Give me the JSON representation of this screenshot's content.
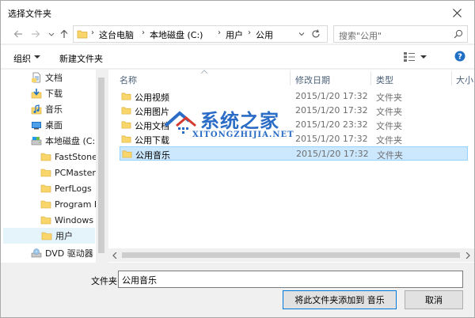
{
  "window": {
    "title": "选择文件夹"
  },
  "address": {
    "crumbs": [
      "这台电脑",
      "本地磁盘 (C:)",
      "用户",
      "公用"
    ]
  },
  "search": {
    "placeholder": "搜索\"公用\""
  },
  "toolbar": {
    "organize": "组织",
    "new_folder": "新建文件夹"
  },
  "sidebar": {
    "items": [
      {
        "label": "文档",
        "icon": "documents-icon"
      },
      {
        "label": "下载",
        "icon": "downloads-icon"
      },
      {
        "label": "音乐",
        "icon": "music-icon"
      },
      {
        "label": "桌面",
        "icon": "desktop-icon"
      },
      {
        "label": "本地磁盘 (C:)",
        "icon": "drive-icon"
      },
      {
        "label": "FastStone",
        "icon": "folder-icon"
      },
      {
        "label": "PCMaster",
        "icon": "folder-icon"
      },
      {
        "label": "PerfLogs",
        "icon": "folder-icon"
      },
      {
        "label": "Program F",
        "icon": "folder-icon"
      },
      {
        "label": "Windows",
        "icon": "folder-icon"
      },
      {
        "label": "用户",
        "icon": "folder-icon",
        "selected": true
      },
      {
        "label": "DVD 驱动器 (",
        "icon": "dvd-drive-icon"
      }
    ]
  },
  "columns": {
    "name": "名称",
    "date": "修改日期",
    "type": "类型",
    "size": "大小"
  },
  "files": [
    {
      "name": "公用视频",
      "date": "2015/1/20 17:32",
      "type": "文件夹"
    },
    {
      "name": "公用图片",
      "date": "2015/1/20 17:32",
      "type": "文件夹"
    },
    {
      "name": "公用文档",
      "date": "2015/1/20 23:32",
      "type": "文件夹"
    },
    {
      "name": "公用下载",
      "date": "2015/1/20 17:32",
      "type": "文件夹"
    },
    {
      "name": "公用音乐",
      "date": "2015/1/20 17:32",
      "type": "文件夹",
      "selected": true
    }
  ],
  "bottom": {
    "folder_label": "文件夹:",
    "folder_value": "公用音乐",
    "add_button": "将此文件夹添加到 音乐",
    "cancel_button": "取消"
  },
  "watermark": {
    "title": "系统之家",
    "subtitle": "XITONGZHIJIA.NET"
  },
  "colors": {
    "accent": "#0078d7",
    "selection": "#cce8ff",
    "folder": "#f8d66b",
    "watermark": "#2a6cc6"
  }
}
